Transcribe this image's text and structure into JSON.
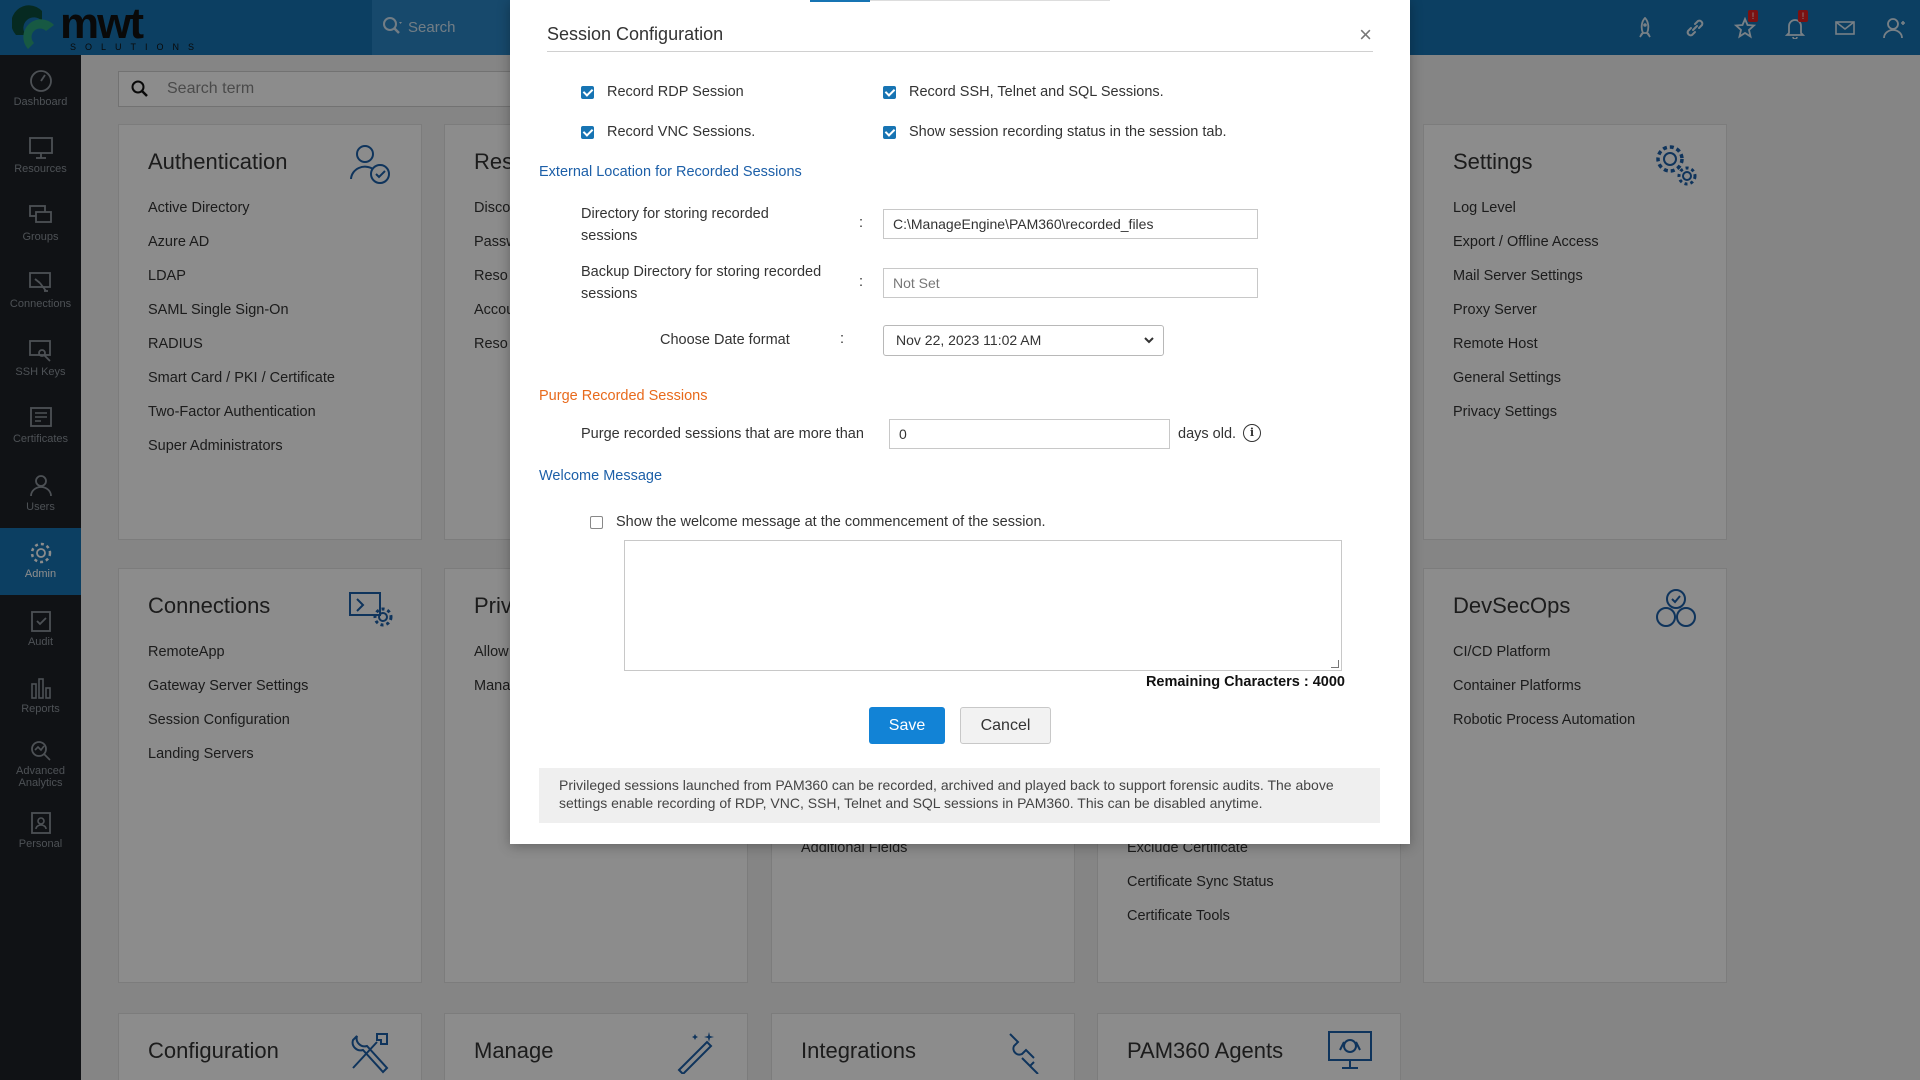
{
  "topbar": {
    "logo_text": "mwt",
    "logo_sub": "SOLUTIONS",
    "search_placeholder": "Search",
    "badge_1": "!",
    "badge_2": "!"
  },
  "sidebar": {
    "items": [
      {
        "label": "Dashboard"
      },
      {
        "label": "Resources"
      },
      {
        "label": "Groups"
      },
      {
        "label": "Connections"
      },
      {
        "label": "SSH Keys"
      },
      {
        "label": "Certificates"
      },
      {
        "label": "Users"
      },
      {
        "label": "Admin"
      },
      {
        "label": "Audit"
      },
      {
        "label": "Reports"
      },
      {
        "label": "Advanced Analytics"
      },
      {
        "label": "Personal"
      }
    ]
  },
  "main_search": {
    "placeholder": "Search term"
  },
  "cards": {
    "authentication": {
      "title": "Authentication",
      "links": [
        "Active Directory",
        "Azure AD",
        "LDAP",
        "SAML Single Sign-On",
        "RADIUS",
        "Smart Card / PKI / Certificate",
        "Two-Factor Authentication",
        "Super Administrators"
      ]
    },
    "resource": {
      "title": "Res",
      "links": [
        "Disco",
        "Passw",
        "Reso",
        "Accou",
        "Reso"
      ]
    },
    "settings": {
      "title": "Settings",
      "links": [
        "Log Level",
        "Export / Offline Access",
        "Mail Server Settings",
        "Proxy Server",
        "Remote Host",
        "General Settings",
        "Privacy Settings"
      ]
    },
    "connections": {
      "title": "Connections",
      "links": [
        "RemoteApp",
        "Gateway Server Settings",
        "Session Configuration",
        "Landing Servers"
      ]
    },
    "privileged": {
      "title": "Priv",
      "links": [
        "Allow",
        "Mana"
      ]
    },
    "customization": {
      "links": [
        "Additional Fields"
      ]
    },
    "certificates": {
      "links": [
        "Exclude Certificate",
        "Certificate Sync Status",
        "Certificate Tools"
      ]
    },
    "devsecops": {
      "title": "DevSecOps",
      "links": [
        "CI/CD Platform",
        "Container Platforms",
        "Robotic Process Automation"
      ]
    },
    "configuration": {
      "title": "Configuration"
    },
    "manage": {
      "title": "Manage"
    },
    "integrations": {
      "title": "Integrations"
    },
    "agents": {
      "title": "PAM360 Agents"
    }
  },
  "modal": {
    "title": "Session Configuration",
    "close": "×",
    "checkboxes": {
      "rdp": {
        "label": "Record RDP Session",
        "checked": true
      },
      "ssh": {
        "label": "Record SSH, Telnet and SQL Sessions.",
        "checked": true
      },
      "vnc": {
        "label": "Record VNC Sessions.",
        "checked": true
      },
      "status": {
        "label": "Show session recording status in the session tab.",
        "checked": true
      }
    },
    "external_location": {
      "heading": "External Location for Recorded Sessions",
      "dir_label": "Directory for storing recorded sessions",
      "dir_value": "C:\\ManageEngine\\PAM360\\recorded_files",
      "backup_label": "Backup Directory for storing recorded sessions",
      "backup_placeholder": "Not Set",
      "date_label": "Choose Date format",
      "date_value": "Nov 22, 2023 11:02 AM",
      "colon": ":"
    },
    "purge": {
      "heading": "Purge Recorded Sessions",
      "label": "Purge recorded sessions that are more than",
      "value": "0",
      "suffix": "days old.",
      "info": "i"
    },
    "welcome": {
      "heading": "Welcome Message",
      "checkbox_label": "Show the welcome message at the commencement of the session.",
      "checked": false,
      "remaining": "Remaining Characters : 4000"
    },
    "buttons": {
      "save": "Save",
      "cancel": "Cancel"
    },
    "note": "Privileged sessions launched from PAM360 can be recorded, archived and played back to support forensic audits. The above settings enable recording of RDP, VNC, SSH, Telnet and SQL sessions in PAM360. This can be disabled anytime."
  }
}
